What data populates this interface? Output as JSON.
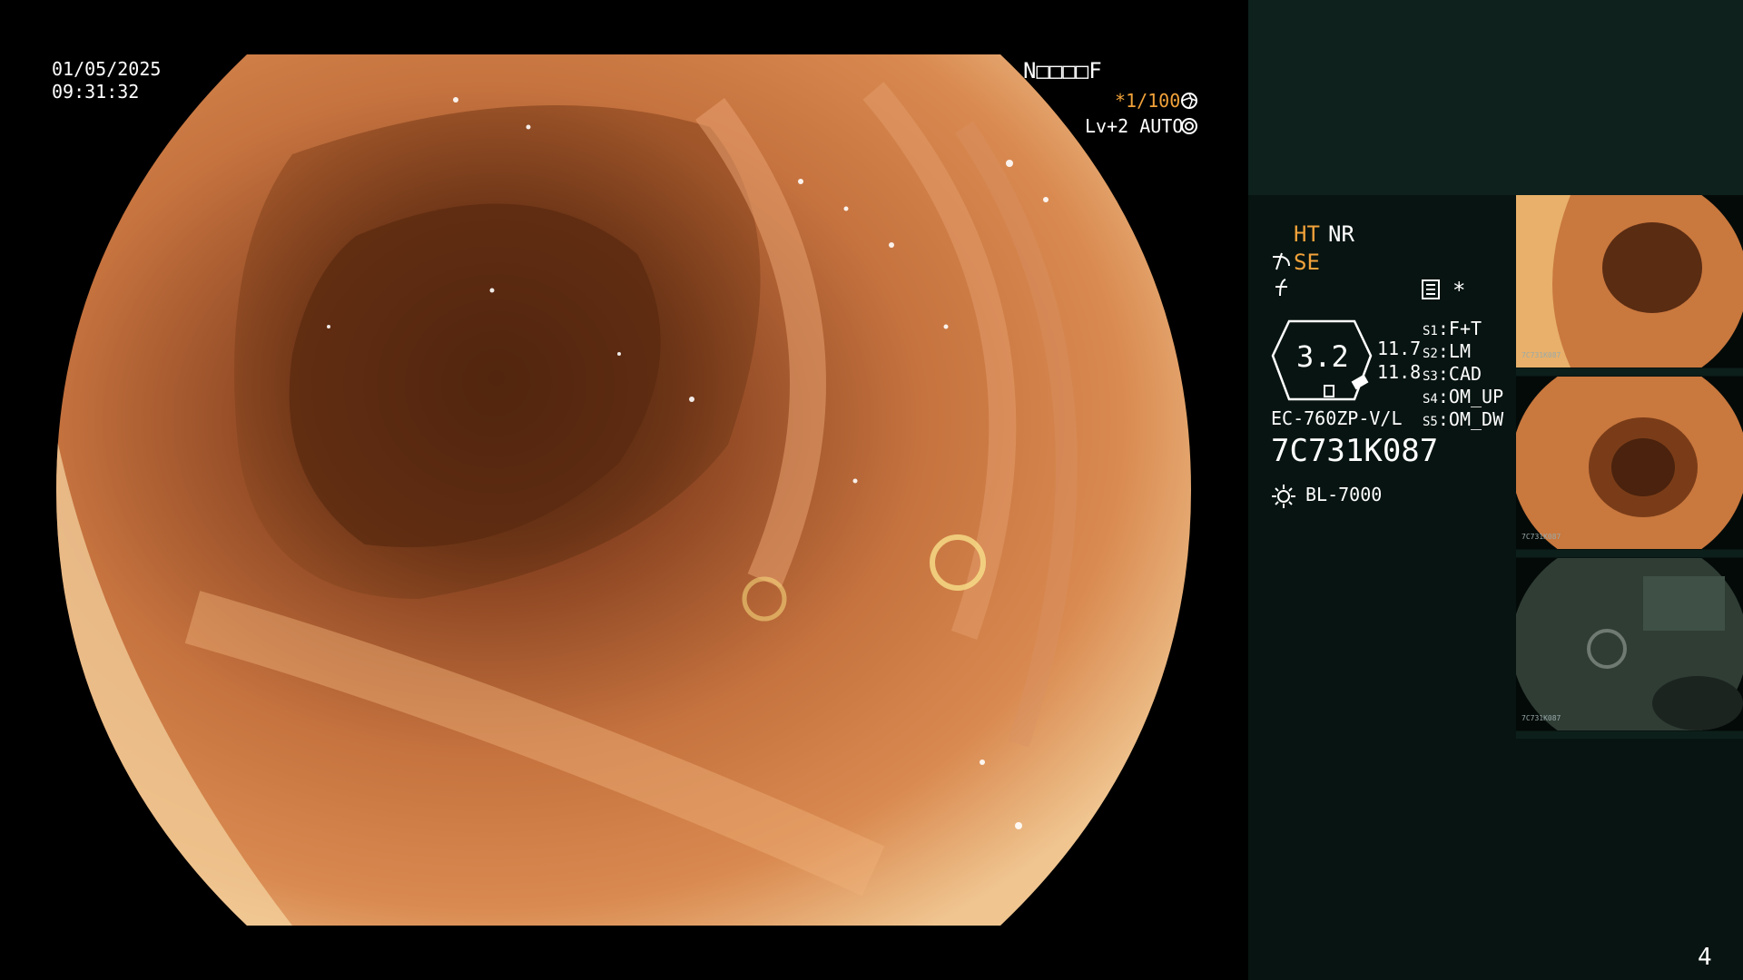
{
  "overlay": {
    "date": "01/05/2025",
    "time": "09:31:32",
    "patient_id": "N□□□□F",
    "shutter": "*1/100",
    "shutter_icon": "aperture-icon",
    "level": "Lv+2 AUTO",
    "level_icon": "auto-iris-icon"
  },
  "panel": {
    "ht": "HT",
    "nr": "NR",
    "se": "SE",
    "se_icon": "structure-enhance-icon",
    "filter_icon": "filter-icon",
    "mode_icon": "settings-icon",
    "asterisk": "*",
    "zoom": "3.2",
    "value_top": "11.7",
    "value_bottom": "11.8",
    "scope_model": "EC-760ZP-V/L",
    "serial": "7C731K087",
    "light_source": "BL-7000",
    "light_icon": "sun-icon",
    "switches": [
      {
        "key": "S1",
        "value": "F+T"
      },
      {
        "key": "S2",
        "value": "LM"
      },
      {
        "key": "S3",
        "value": "CAD"
      },
      {
        "key": "S4",
        "value": "OM_UP"
      },
      {
        "key": "S5",
        "value": "OM_DW"
      }
    ]
  },
  "thumbnails": [
    {
      "label": "7C731K087"
    },
    {
      "label": "7C731K087"
    },
    {
      "label": "7C731K087"
    }
  ],
  "page_number": "4",
  "colors": {
    "accent": "#f2a23a",
    "panel_bg": "#071411",
    "panel_top": "#0e211d"
  }
}
